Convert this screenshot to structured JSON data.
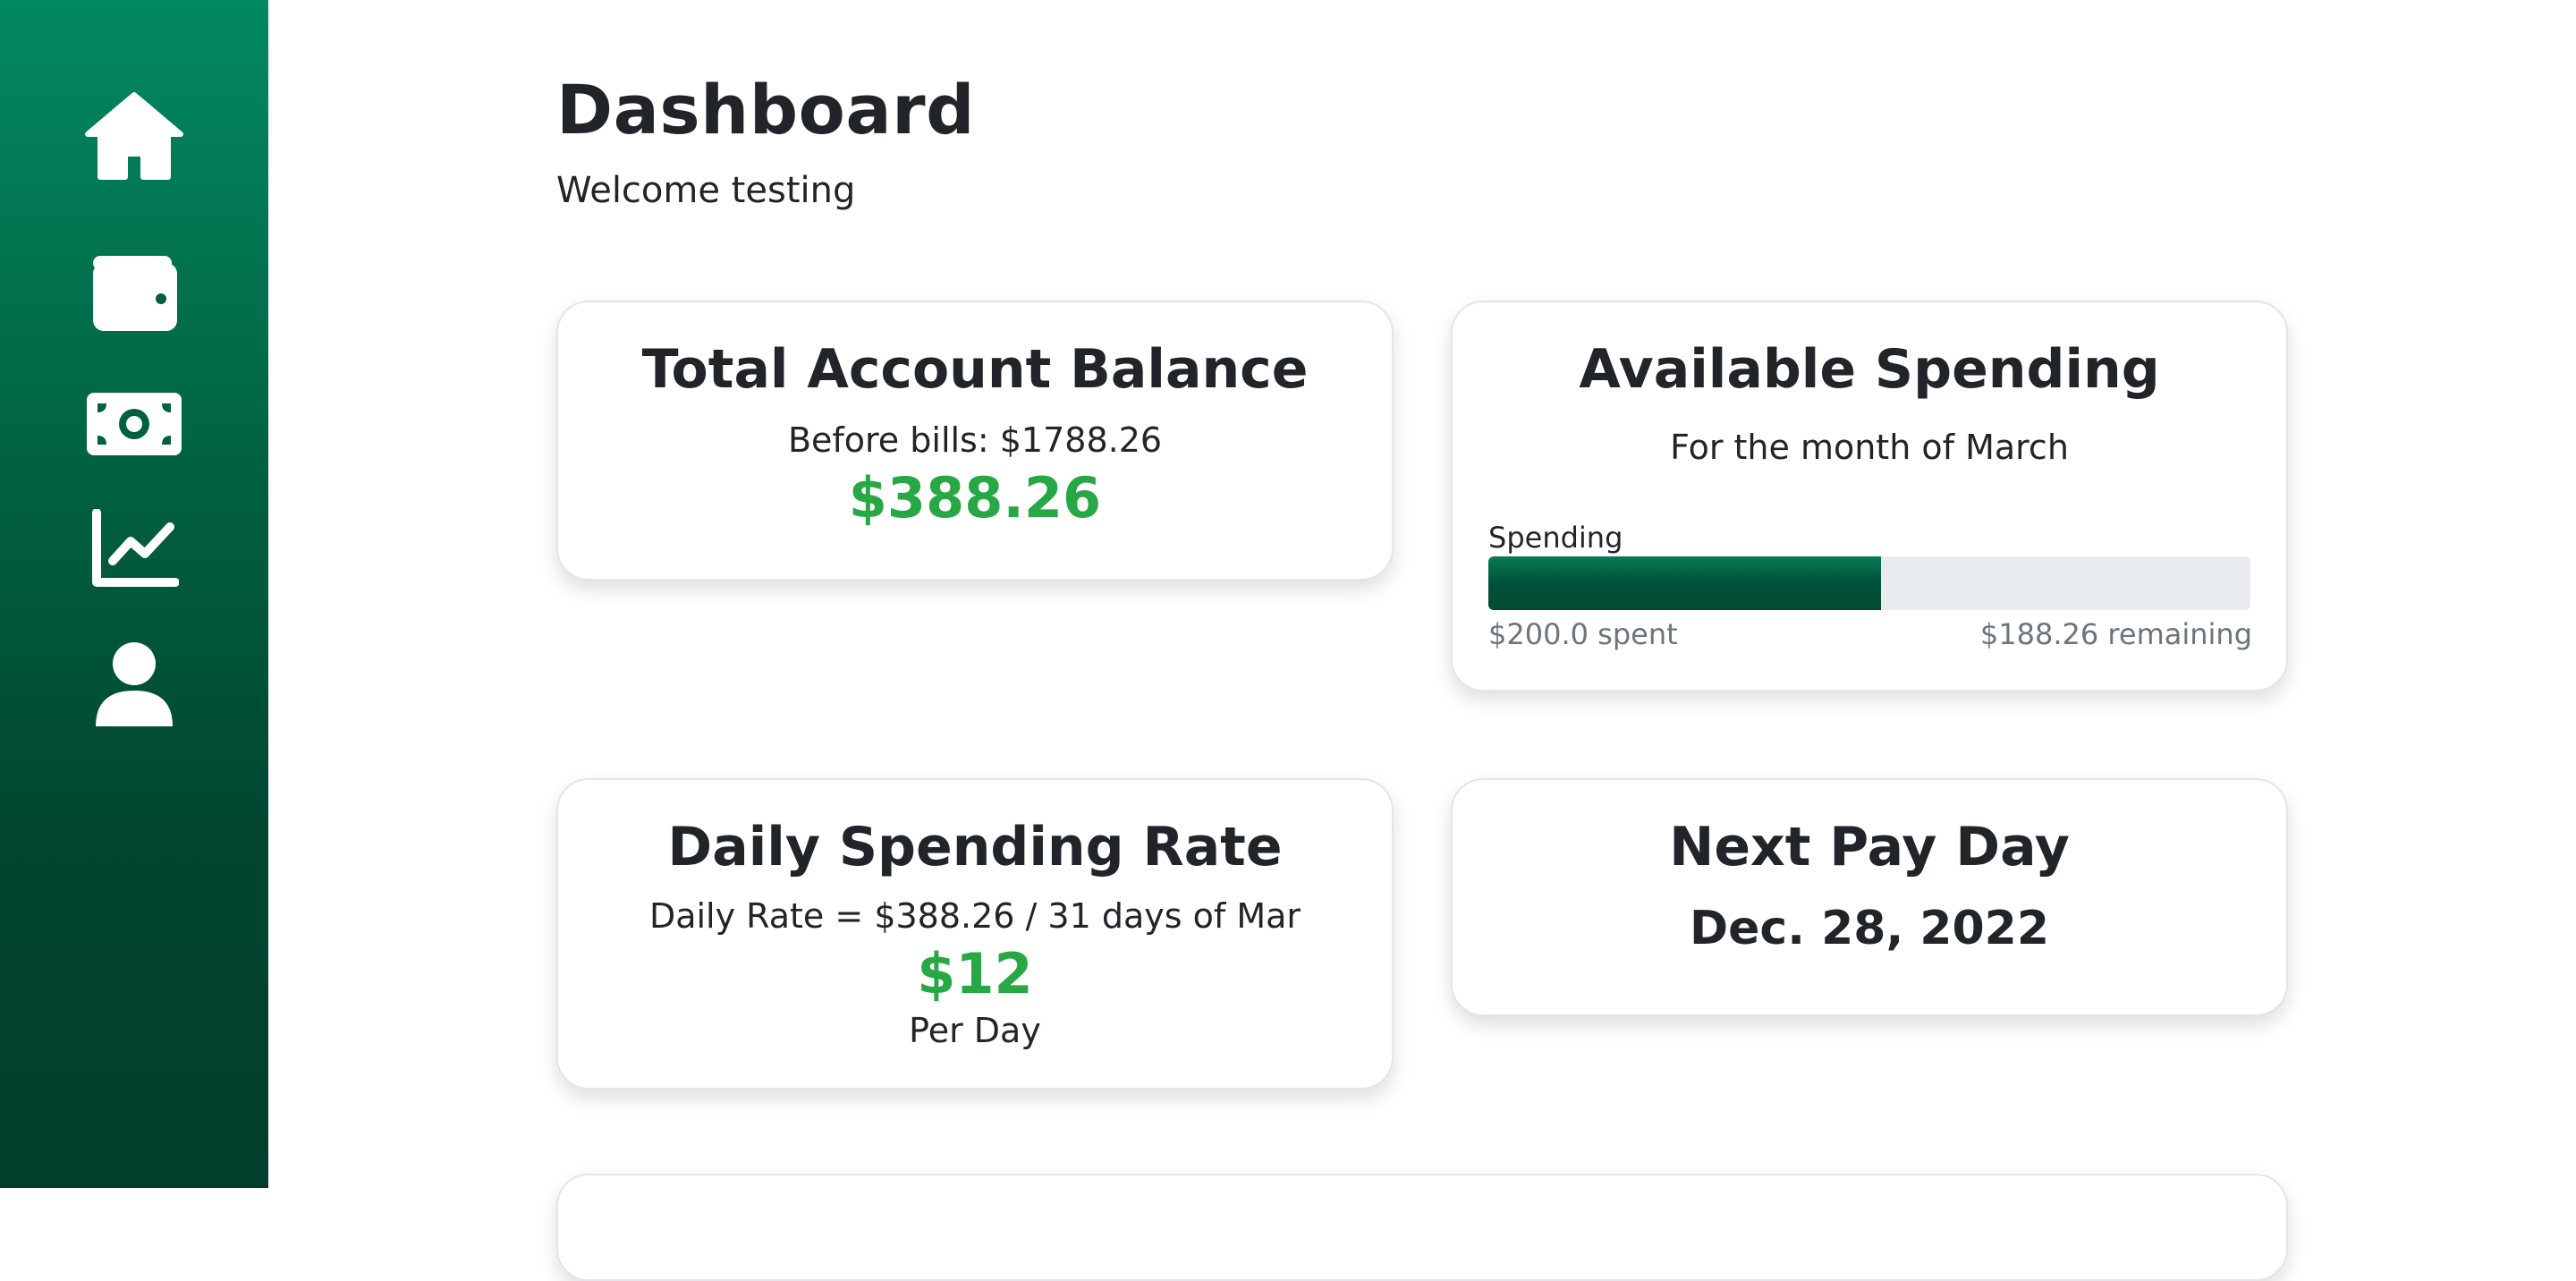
{
  "app": {
    "theme_colors": {
      "sidebar_top": "#028962",
      "sidebar_bottom": "#013e2b",
      "accent_green": "#28a745",
      "progress_fill": "#01513a",
      "progress_track": "#e9ecef"
    }
  },
  "sidebar": {
    "items": [
      {
        "icon": "home-icon"
      },
      {
        "icon": "wallet-icon"
      },
      {
        "icon": "money-bill-icon"
      },
      {
        "icon": "chart-line-icon"
      },
      {
        "icon": "user-icon"
      }
    ]
  },
  "header": {
    "title": "Dashboard",
    "welcome": "Welcome testing"
  },
  "cards": {
    "balance": {
      "title": "Total Account Balance",
      "before_bills": "Before bills: $1788.26",
      "amount": "$388.26"
    },
    "spending": {
      "title": "Available Spending",
      "subtitle": "For the month of March",
      "progress_label": "Spending",
      "progress_fraction": 0.515,
      "spent_text": "$200.0 spent",
      "remaining_text": "$188.26 remaining"
    },
    "daily": {
      "title": "Daily Spending Rate",
      "formula": "Daily Rate = $388.26 / 31 days of Mar",
      "amount": "$12",
      "unit": "Per Day"
    },
    "payday": {
      "title": "Next Pay Day",
      "date": "Dec. 28, 2022"
    }
  }
}
